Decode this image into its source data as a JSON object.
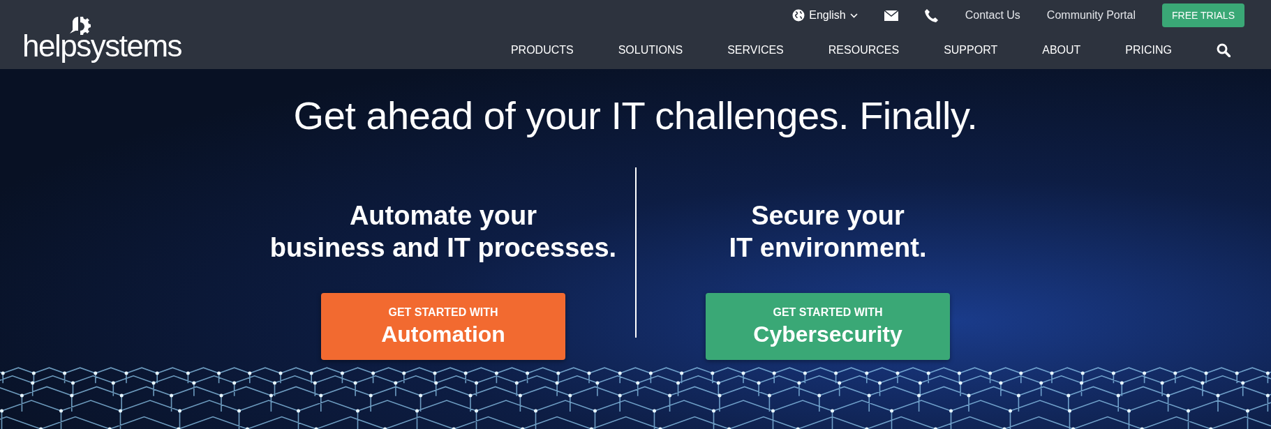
{
  "logo": {
    "text": "helpsystems"
  },
  "utility_bar": {
    "language": "English",
    "links": [
      "Contact Us",
      "Community Portal"
    ],
    "cta": "FREE TRIALS"
  },
  "nav": {
    "items": [
      "PRODUCTS",
      "SOLUTIONS",
      "SERVICES",
      "RESOURCES",
      "SUPPORT",
      "ABOUT",
      "PRICING"
    ]
  },
  "hero": {
    "headline": "Get ahead of your IT challenges. Finally.",
    "columns": [
      {
        "kind": "automation",
        "title_lines": [
          "Automate your",
          "business and IT processes."
        ],
        "button_small": "GET STARTED WITH",
        "button_big": "Automation"
      },
      {
        "kind": "security",
        "title_lines": [
          "Secure your",
          "IT environment."
        ],
        "button_small": "GET STARTED WITH",
        "button_big": "Cybersecurity"
      }
    ]
  }
}
